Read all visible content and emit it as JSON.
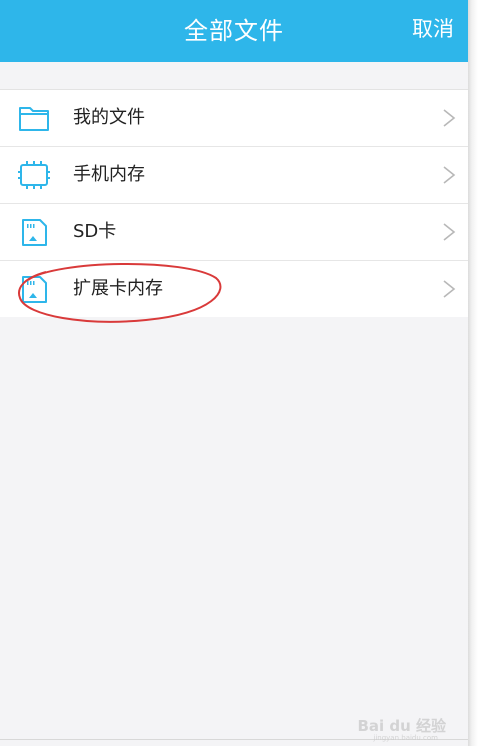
{
  "header": {
    "title": "全部文件",
    "cancel_label": "取消"
  },
  "items": [
    {
      "label": "我的文件",
      "icon": "folder-icon"
    },
    {
      "label": "手机内存",
      "icon": "phone-memory-icon"
    },
    {
      "label": "SD卡",
      "icon": "sd-card-icon"
    },
    {
      "label": "扩展卡内存",
      "icon": "sd-card-icon"
    }
  ],
  "watermark": {
    "text": "Bai du 经验",
    "sub": "jingyan.baidu.com"
  },
  "colors": {
    "header_bg": "#2eb6ea",
    "icon": "#2eb6ea",
    "annotation": "#d93a3a",
    "background": "#f4f4f6"
  }
}
